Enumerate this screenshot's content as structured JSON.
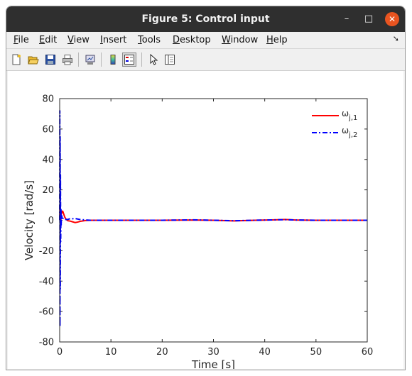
{
  "window": {
    "title": "Figure 5: Control input",
    "controls": {
      "minimize": "–",
      "maximize": "□",
      "close": "✕"
    }
  },
  "menubar": {
    "items": [
      {
        "label": "File",
        "accel": "F"
      },
      {
        "label": "Edit",
        "accel": "E"
      },
      {
        "label": "View",
        "accel": "V"
      },
      {
        "label": "Insert",
        "accel": "I"
      },
      {
        "label": "Tools",
        "accel": "T"
      },
      {
        "label": "Desktop",
        "accel": "D"
      },
      {
        "label": "Window",
        "accel": "W"
      },
      {
        "label": "Help",
        "accel": "H"
      }
    ],
    "overflow_icon": "dock-arrow-icon"
  },
  "toolbar": {
    "buttons": [
      "new-figure-icon",
      "open-file-icon",
      "save-icon",
      "print-icon",
      "link-figure-icon",
      "colorbar-icon",
      "legend-icon",
      "pointer-icon",
      "property-editor-icon"
    ],
    "active": "legend-icon"
  },
  "chart_data": {
    "type": "line",
    "xlabel": "Time [s]",
    "ylabel": "Velocity [rad/s]",
    "xlim": [
      0,
      60
    ],
    "ylim": [
      -80,
      80
    ],
    "xticks": [
      0,
      10,
      20,
      30,
      40,
      50,
      60
    ],
    "yticks": [
      -80,
      -60,
      -40,
      -20,
      0,
      20,
      40,
      60,
      80
    ],
    "grid": false,
    "legend_position": "top-right",
    "series": [
      {
        "name": "ω_j,1",
        "legend_symbol": "ω",
        "legend_sub": "j,1",
        "color": "#ff0000",
        "style": "solid",
        "x": [
          0,
          0.05,
          0.1,
          0.15,
          0.2,
          0.3,
          0.4,
          0.5,
          0.6,
          0.8,
          1.0,
          1.3,
          1.6,
          2.0,
          2.5,
          3.0,
          3.5,
          4.0,
          5.0,
          6.0,
          8.0,
          10,
          20,
          26,
          30,
          34,
          38,
          42,
          44,
          46,
          50,
          55,
          60
        ],
        "y": [
          0,
          9,
          -6,
          5,
          -2,
          4,
          6,
          5,
          6,
          4,
          2,
          0.5,
          -0.3,
          -0.5,
          -1,
          -1.5,
          -1.2,
          -0.7,
          -0.2,
          0,
          0,
          0,
          0,
          0.2,
          0,
          -0.4,
          0,
          0.3,
          0.5,
          0.2,
          0,
          0,
          0
        ]
      },
      {
        "name": "ω_j,2",
        "legend_symbol": "ω",
        "legend_sub": "j,2",
        "color": "#0000ff",
        "style": "dashdot",
        "x": [
          0,
          0.03,
          0.06,
          0.09,
          0.12,
          0.15,
          0.2,
          0.25,
          0.3,
          0.35,
          0.4,
          0.5,
          0.6,
          0.8,
          1.0,
          1.5,
          2.0,
          2.5,
          3.0,
          3.5,
          4.0,
          5.0,
          6.0,
          8.0,
          10,
          20,
          26,
          30,
          34,
          38,
          42,
          44,
          46,
          50,
          55,
          60
        ],
        "y": [
          0,
          72,
          -70,
          55,
          -45,
          30,
          -14,
          8,
          -3,
          2,
          3,
          1,
          1.5,
          0.5,
          0.5,
          0.5,
          1,
          1,
          1.2,
          0.8,
          0.5,
          0.2,
          0,
          0,
          0,
          0,
          0.3,
          0,
          -0.3,
          0,
          0.3,
          0.4,
          0.2,
          0,
          0,
          0
        ]
      }
    ]
  }
}
